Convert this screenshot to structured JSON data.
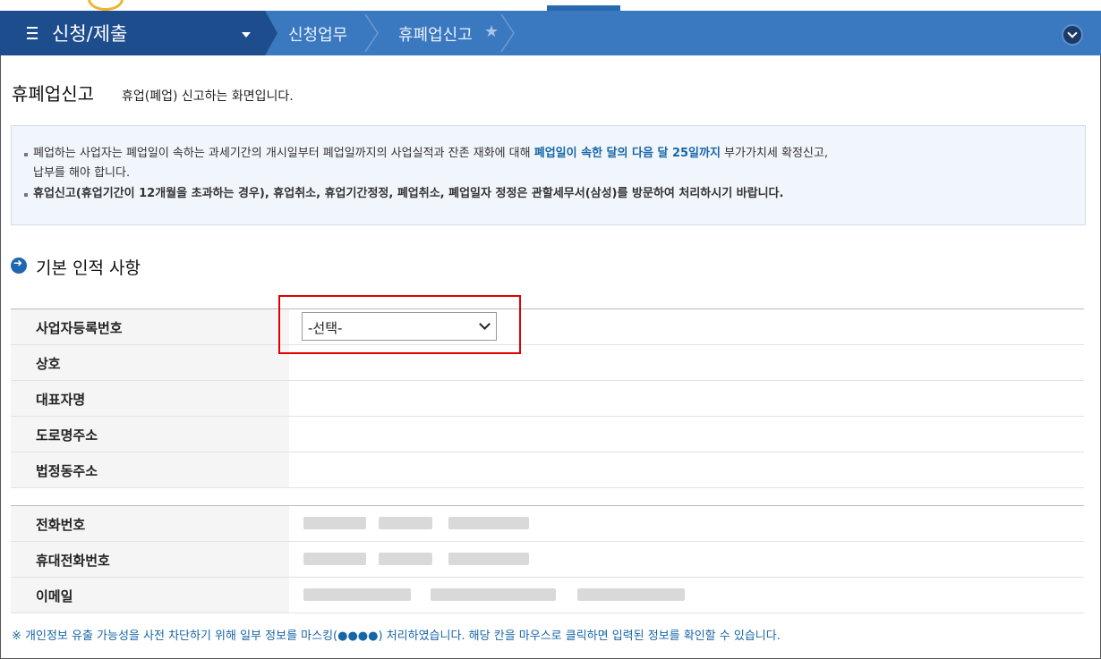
{
  "nav": {
    "title": "신청/제출",
    "crumbs": [
      "신청업무",
      "휴폐업신고"
    ]
  },
  "page": {
    "title": "휴폐업신고",
    "description": "휴업(폐업) 신고하는 화면입니다."
  },
  "info": {
    "line1_a": "폐업하는 사업자는 폐업일이 속하는 과세기간의 개시일부터 폐업일까지의 사업실적과 잔존 재화에 대해 ",
    "line1_hl": "폐업일이 속한 달의 다음 달 25일까지",
    "line1_b": " 부가가치세 확정신고,",
    "line2": "납부를 해야 합니다.",
    "line3": "휴업신고(휴업기간이 12개월을 초과하는 경우), 휴업취소, 휴업기간정정, 폐업취소, 폐업일자 정정은 관할세무서(삼성)를 방문하여 처리하시기 바랍니다."
  },
  "section": {
    "title": "기본 인적 사항"
  },
  "form": {
    "labels": [
      "사업자등록번호",
      "상호",
      "대표자명",
      "도로명주소",
      "법정동주소"
    ],
    "select_value": "-선택-",
    "contact_labels": [
      "전화번호",
      "휴대전화번호",
      "이메일"
    ]
  },
  "footnote": "※ 개인정보 유출 가능성을 사전 차단하기 위해 일부 정보를 마스킹(●●●●) 처리하였습니다. 해당 칸을 마우스로 클릭하면 입력된 정보를 확인할 수 있습니다.",
  "colors": {
    "nav_dark": "#1e4d8d",
    "nav": "#3a78c0",
    "accent": "#1766a8",
    "highlight": "#e00000"
  }
}
